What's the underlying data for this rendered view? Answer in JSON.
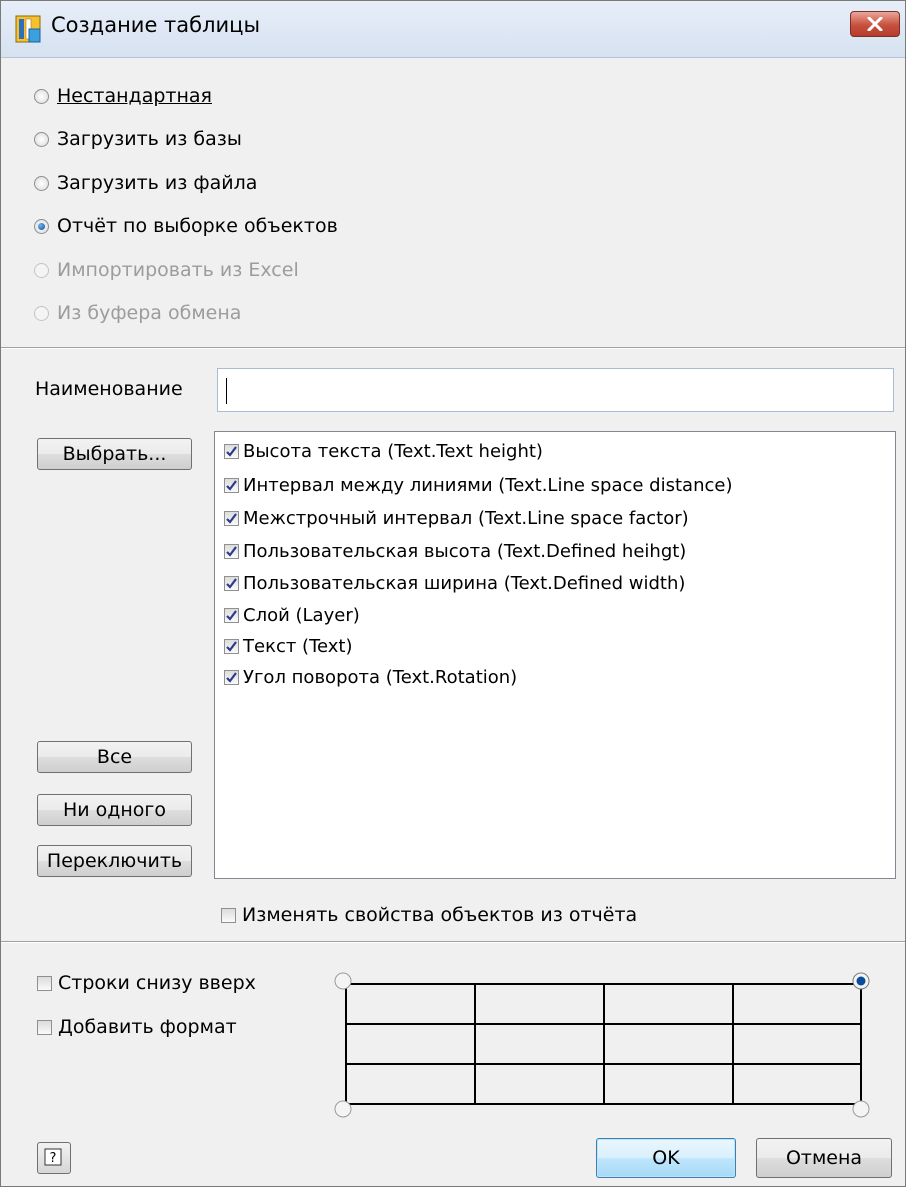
{
  "window": {
    "title": "Создание таблицы"
  },
  "source_options": [
    {
      "label": "Нестандартная",
      "selected": false,
      "disabled": false
    },
    {
      "label": "Загрузить из базы",
      "selected": false,
      "disabled": false
    },
    {
      "label": "Загрузить из файла",
      "selected": false,
      "disabled": false
    },
    {
      "label": "Отчёт по выборке объектов",
      "selected": true,
      "disabled": false
    },
    {
      "label": "Импортировать из Excel",
      "selected": false,
      "disabled": true
    },
    {
      "label": "Из буфера обмена",
      "selected": false,
      "disabled": true
    }
  ],
  "name_field": {
    "label": "Наименование",
    "value": ""
  },
  "buttons": {
    "select": "Выбрать...",
    "all": "Все",
    "none": "Ни одного",
    "toggle": "Переключить",
    "ok": "OK",
    "cancel": "Отмена"
  },
  "properties": [
    {
      "label": "Высота текста (Text.Text height)",
      "checked": true
    },
    {
      "label": "Интервал между линиями (Text.Line space distance)",
      "checked": true
    },
    {
      "label": "Межстрочный интервал (Text.Line space factor)",
      "checked": true
    },
    {
      "label": "Пользовательская высота (Text.Defined heihgt)",
      "checked": true
    },
    {
      "label": "Пользовательская ширина (Text.Defined width)",
      "checked": true
    },
    {
      "label": "Слой (Layer)",
      "checked": true
    },
    {
      "label": "Текст (Text)",
      "checked": true
    },
    {
      "label": "Угол поворота (Text.Rotation)",
      "checked": true
    }
  ],
  "options": {
    "modify_from_report": {
      "label": "Изменять свойства объектов из отчёта",
      "checked": false
    },
    "rows_bottom_up": {
      "label": "Строки снизу вверх",
      "checked": false
    },
    "add_format": {
      "label": "Добавить формат",
      "checked": false
    }
  },
  "preview": {
    "selected_corner": "top-right",
    "rows": 3,
    "columns": 4
  },
  "colors": {
    "accent": "#3c7fb1",
    "close": "#c7503d"
  }
}
